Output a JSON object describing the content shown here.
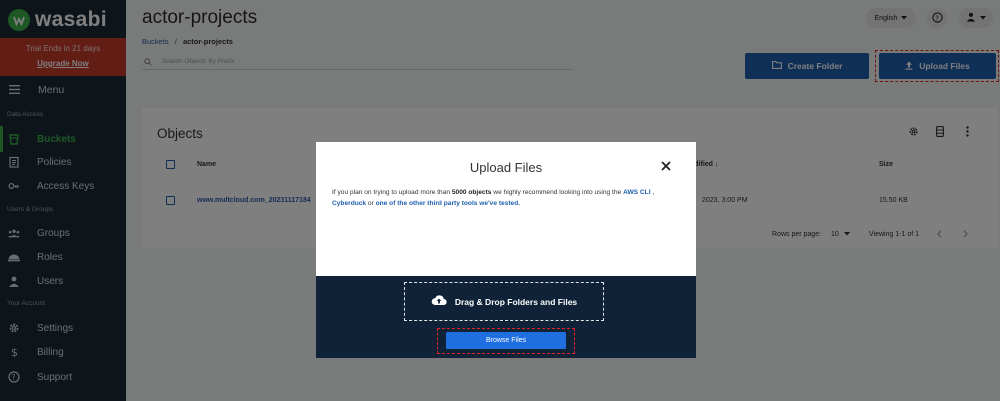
{
  "brand": {
    "name": "wasabi"
  },
  "trial": {
    "text": "Trial Ends in 21 days",
    "upgrade_label": "Upgrade Now"
  },
  "sidebar": {
    "menu_label": "Menu",
    "sections": [
      {
        "heading": "Data Access",
        "items": [
          {
            "label": "Buckets",
            "icon": "bucket-icon",
            "active": true
          },
          {
            "label": "Policies",
            "icon": "policy-icon"
          },
          {
            "label": "Access Keys",
            "icon": "key-icon"
          }
        ]
      },
      {
        "heading": "Users & Groups",
        "items": [
          {
            "label": "Groups",
            "icon": "groups-icon"
          },
          {
            "label": "Roles",
            "icon": "roles-icon"
          },
          {
            "label": "Users",
            "icon": "users-icon"
          }
        ]
      },
      {
        "heading": "Your Account",
        "items": [
          {
            "label": "Settings",
            "icon": "gear-icon"
          },
          {
            "label": "Billing",
            "icon": "dollar-icon"
          },
          {
            "label": "Support",
            "icon": "help-icon"
          }
        ]
      }
    ]
  },
  "header": {
    "title": "actor-projects",
    "breadcrumb": {
      "root": "Buckets",
      "separator": "/",
      "current": "actor-projects"
    },
    "language": "English",
    "search_placeholder": "Search Objects By Prefix",
    "create_folder_label": "Create Folder",
    "upload_files_label": "Upload Files"
  },
  "objects": {
    "title": "Objects",
    "columns": {
      "name": "Name",
      "modified": "odified ↓",
      "size": "Size"
    },
    "rows": [
      {
        "name": "www.multcloud.com_20231117184",
        "modified": "2023, 3:00 PM",
        "size": "15.50 KB"
      }
    ],
    "pagination": {
      "rows_per_page_label": "Rows per page:",
      "rows_per_page": "10",
      "range": "Viewing 1-1 of 1"
    }
  },
  "modal": {
    "title": "Upload Files",
    "text_1": "If you plan on trying to upload more than ",
    "text_bold": "5000 objects",
    "text_2": " we highly recommend looking into using the ",
    "link_aws": "AWS CLI",
    "text_3": " , ",
    "link_cyberduck": "Cyberduck",
    "text_4": " or ",
    "link_other": "one of the other third party tools we've tested.",
    "dropzone_label": "Drag & Drop Folders and Files",
    "browse_label": "Browse Files"
  },
  "colors": {
    "sidebar_bg": "#1b2a36",
    "brand_green": "#3db24b",
    "trial_red": "#c43a28",
    "primary_blue": "#1f5fae",
    "highlight_red": "#e02424",
    "dropzone_bg": "#0f2237"
  }
}
